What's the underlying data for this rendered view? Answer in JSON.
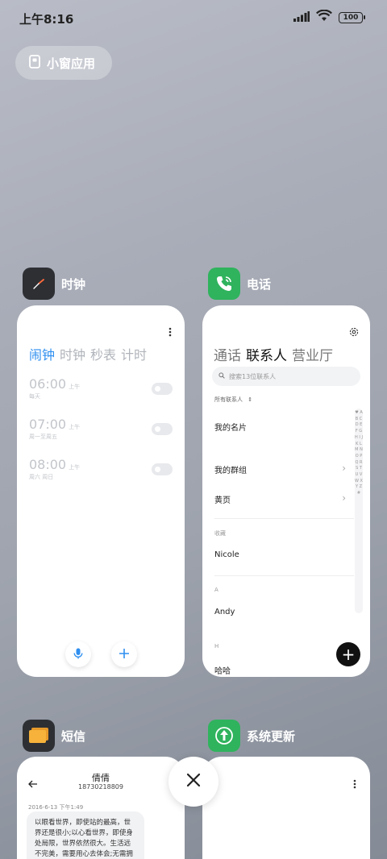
{
  "status_bar": {
    "time": "上午8:16",
    "battery": "100"
  },
  "small_window": {
    "label": "小窗应用"
  },
  "apps": {
    "clock": {
      "name": "时钟",
      "tabs": [
        "闹钟",
        "时钟",
        "秒表",
        "计时"
      ],
      "alarms": [
        {
          "time": "06:00",
          "ampm": "上午",
          "repeat": "每天",
          "enabled": false
        },
        {
          "time": "07:00",
          "ampm": "上午",
          "repeat": "周一至周五",
          "enabled": false
        },
        {
          "time": "08:00",
          "ampm": "上午",
          "repeat": "周六 周日",
          "enabled": false
        }
      ]
    },
    "phone": {
      "name": "电话",
      "tabs": [
        "通话",
        "联系人",
        "营业厅"
      ],
      "search_placeholder": "搜索13位联系人",
      "filter": "所有联系人",
      "rows": {
        "my_card": "我的名片",
        "my_groups": "我的群组",
        "yellow_pages": "黄页",
        "favorites_header": "收藏",
        "fav_1": "Nicole",
        "section_a": "A",
        "contact_a": "Andy",
        "section_h": "H",
        "contact_h": "哈哈"
      },
      "alphabet": "♥ A B C D E F G H I J K L M N O P Q R S T U V W X Y Z #"
    },
    "sms": {
      "name": "短信",
      "contact_name": "倩倩",
      "contact_number": "18730218809",
      "date": "2016-6-13 下午1:49",
      "message": "以眼看世界，即使站的最高，世界还是很小;以心看世界，即使身处局限，世界依然很大。生活远不完美，需要用心去体会;无需拥有太"
    },
    "system_update": {
      "name": "系统更新"
    }
  },
  "colors": {
    "clock_accent": "#2f8ff0",
    "phone_icon": "#2fb35d",
    "update_icon": "#2fb35d",
    "sms_icon": "#f6b23a"
  }
}
